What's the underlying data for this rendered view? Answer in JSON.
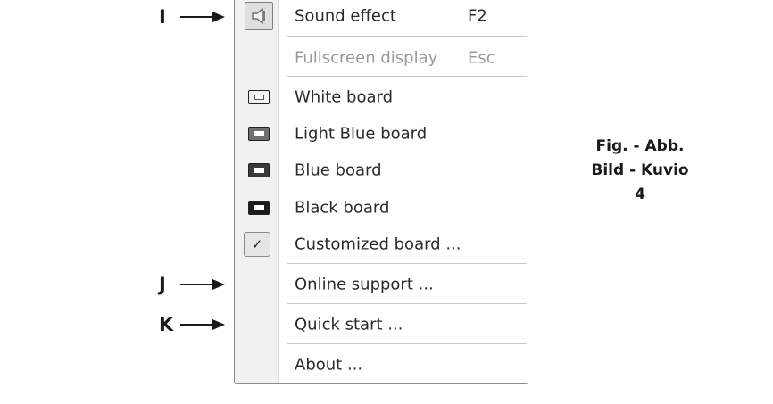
{
  "menu": {
    "items": [
      {
        "label": "Sound effect",
        "shortcut": "F2",
        "icon": "speaker-icon"
      },
      {
        "label": "Fullscreen display",
        "shortcut": "Esc",
        "disabled": true
      },
      {
        "label": "White board",
        "icon": "white-board-icon",
        "board_color": "#f2f2f2"
      },
      {
        "label": "Light Blue board",
        "icon": "light-blue-board-icon",
        "board_color": "#6f6f6f"
      },
      {
        "label": "Blue board",
        "icon": "blue-board-icon",
        "board_color": "#3a3a3a"
      },
      {
        "label": "Black board",
        "icon": "black-board-icon",
        "board_color": "#1c1c1c"
      },
      {
        "label": "Customized board ...",
        "icon": "checkmark-icon",
        "checked": true
      },
      {
        "label": "Online support ..."
      },
      {
        "label": "Quick start ..."
      },
      {
        "label": "About ..."
      }
    ]
  },
  "callouts": {
    "i": "I",
    "j": "J",
    "k": "K"
  },
  "caption": {
    "line1": "Fig. - Abb.",
    "line2": "Bild - Kuvio",
    "line3": "4"
  },
  "icons": {
    "check_glyph": "✓"
  }
}
